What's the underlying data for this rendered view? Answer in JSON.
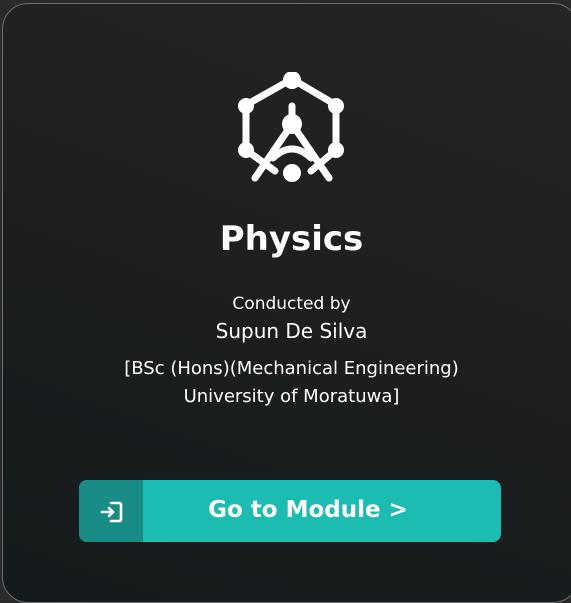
{
  "card": {
    "subject": "Physics",
    "conducted_by_label": "Conducted by",
    "teacher_name": "Supun De Silva",
    "qualification_line1": "[BSc (Hons)(Mechanical Engineering)",
    "qualification_line2": "University of Moratuwa]",
    "subject_icon": "physics-atom-icon",
    "button": {
      "label": "Go to Module >",
      "icon": "sign-in-icon"
    }
  },
  "colors": {
    "accent": "#1cbcb3",
    "accent_dark": "#1a8c86",
    "card_border": "#6b6f73",
    "text": "#ffffff"
  }
}
